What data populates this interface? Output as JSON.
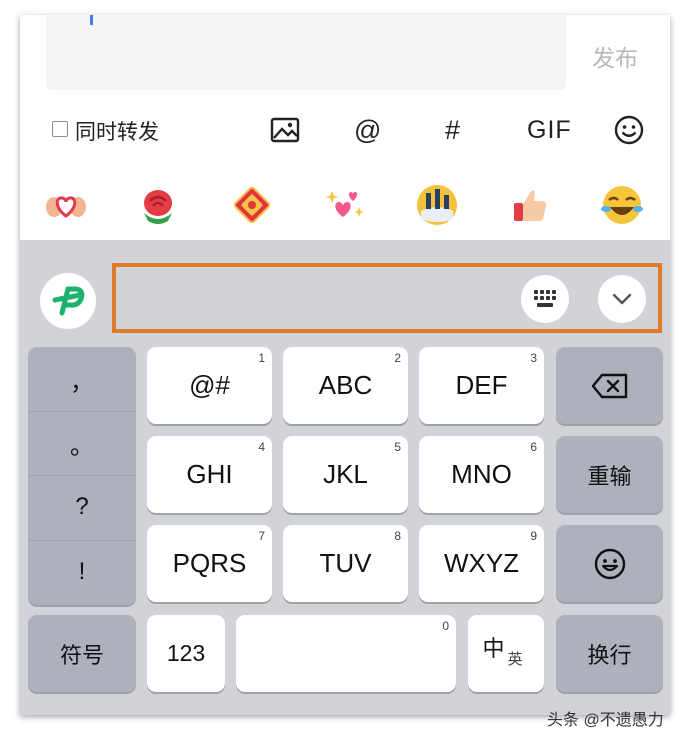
{
  "compose": {
    "publish_label": "发布"
  },
  "toolbar": {
    "repost_label": "同时转发",
    "mention_label": "@",
    "topic_label": "#",
    "gif_label": "GIF"
  },
  "emoji_row": {
    "items": [
      "heart-hands",
      "rose",
      "red-envelope",
      "sparkling-hearts",
      "candle-cake",
      "thumbs-up",
      "laughing-crying"
    ]
  },
  "keyboard": {
    "punct_keys": [
      "，",
      "。",
      "?",
      "!"
    ],
    "keys_row1": [
      {
        "label": "@#",
        "num": "1"
      },
      {
        "label": "ABC",
        "num": "2"
      },
      {
        "label": "DEF",
        "num": "3"
      }
    ],
    "keys_row2": [
      {
        "label": "GHI",
        "num": "4"
      },
      {
        "label": "JKL",
        "num": "5"
      },
      {
        "label": "MNO",
        "num": "6"
      }
    ],
    "keys_row3": [
      {
        "label": "PQRS",
        "num": "7"
      },
      {
        "label": "TUV",
        "num": "8"
      },
      {
        "label": "WXYZ",
        "num": "9"
      }
    ],
    "reinput_label": "重输",
    "symbols_label": "符号",
    "numbers_label": "123",
    "space_num": "0",
    "lang_main": "中",
    "lang_sub": "英",
    "newline_label": "换行"
  },
  "watermark": "头条 @不遗愚力",
  "colors": {
    "highlight": "#e07b2a",
    "logo_green": "#1bb26b",
    "keyboard_bg": "#d1d3d9",
    "key_gray": "#acb1bb"
  }
}
